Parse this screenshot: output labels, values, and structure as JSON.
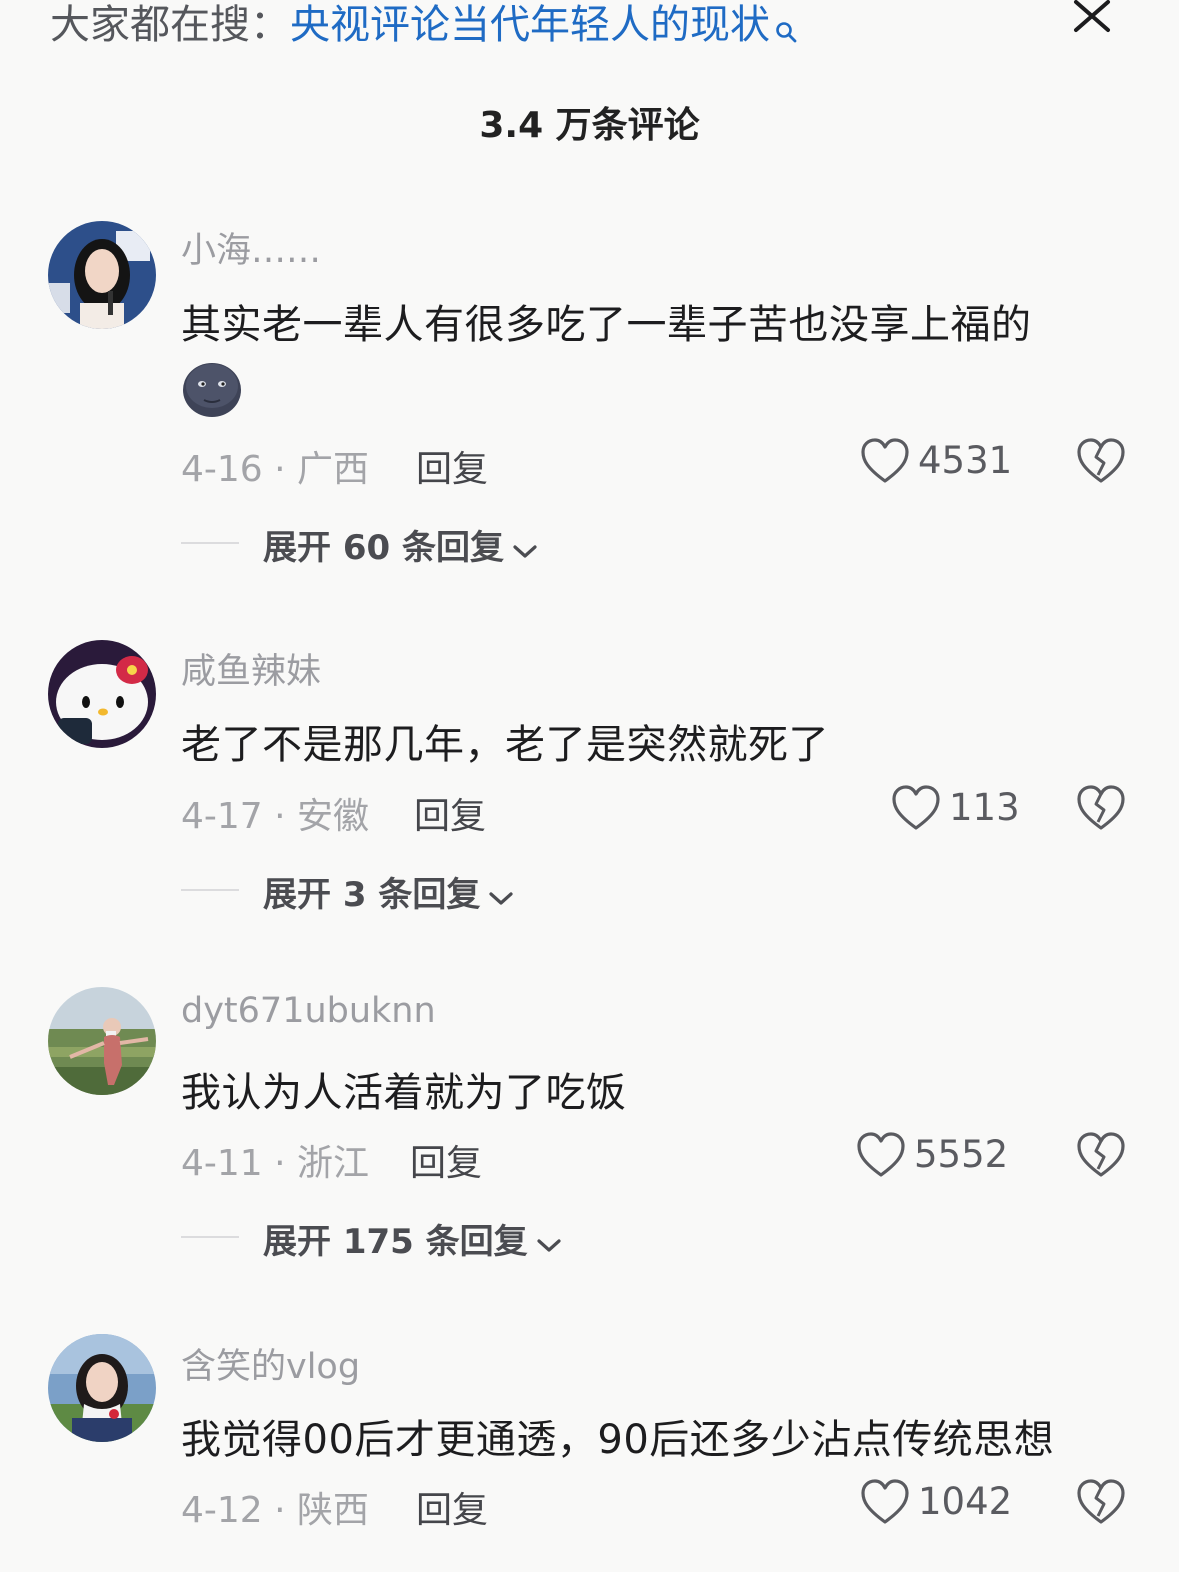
{
  "header": {
    "search_prefix": "大家都在搜：",
    "search_query": "央视评论当代年轻人的现状",
    "comment_count_title": "3.4 万条评论"
  },
  "colors": {
    "link_blue": "#1f6bc4",
    "background": "#f9f9f8",
    "muted_text": "#9b9ca1"
  },
  "comments": [
    {
      "username": "小海……",
      "content": "其实老一辈人有很多吃了一辈子苦也没享上福的",
      "emoji": "new-moon-face-emoji",
      "date_location": "4-16 · 广西",
      "reply_label": "回复",
      "likes": "4531",
      "expand_label": "展开 60 条回复"
    },
    {
      "username": "咸鱼辣妹",
      "content": "老了不是那几年，老了是突然就死了",
      "date_location": "4-17 · 安徽",
      "reply_label": "回复",
      "likes": "113",
      "expand_label": "展开 3 条回复"
    },
    {
      "username": "dyt671ubuknn",
      "content": "我认为人活着就为了吃饭",
      "date_location": "4-11 · 浙江",
      "reply_label": "回复",
      "likes": "5552",
      "expand_label": "展开 175 条回复"
    },
    {
      "username": "含笑的vlog",
      "content": "我觉得00后才更通透，90后还多少沾点传统思想",
      "date_location": "4-12 · 陕西",
      "reply_label": "回复",
      "likes": "1042"
    }
  ]
}
